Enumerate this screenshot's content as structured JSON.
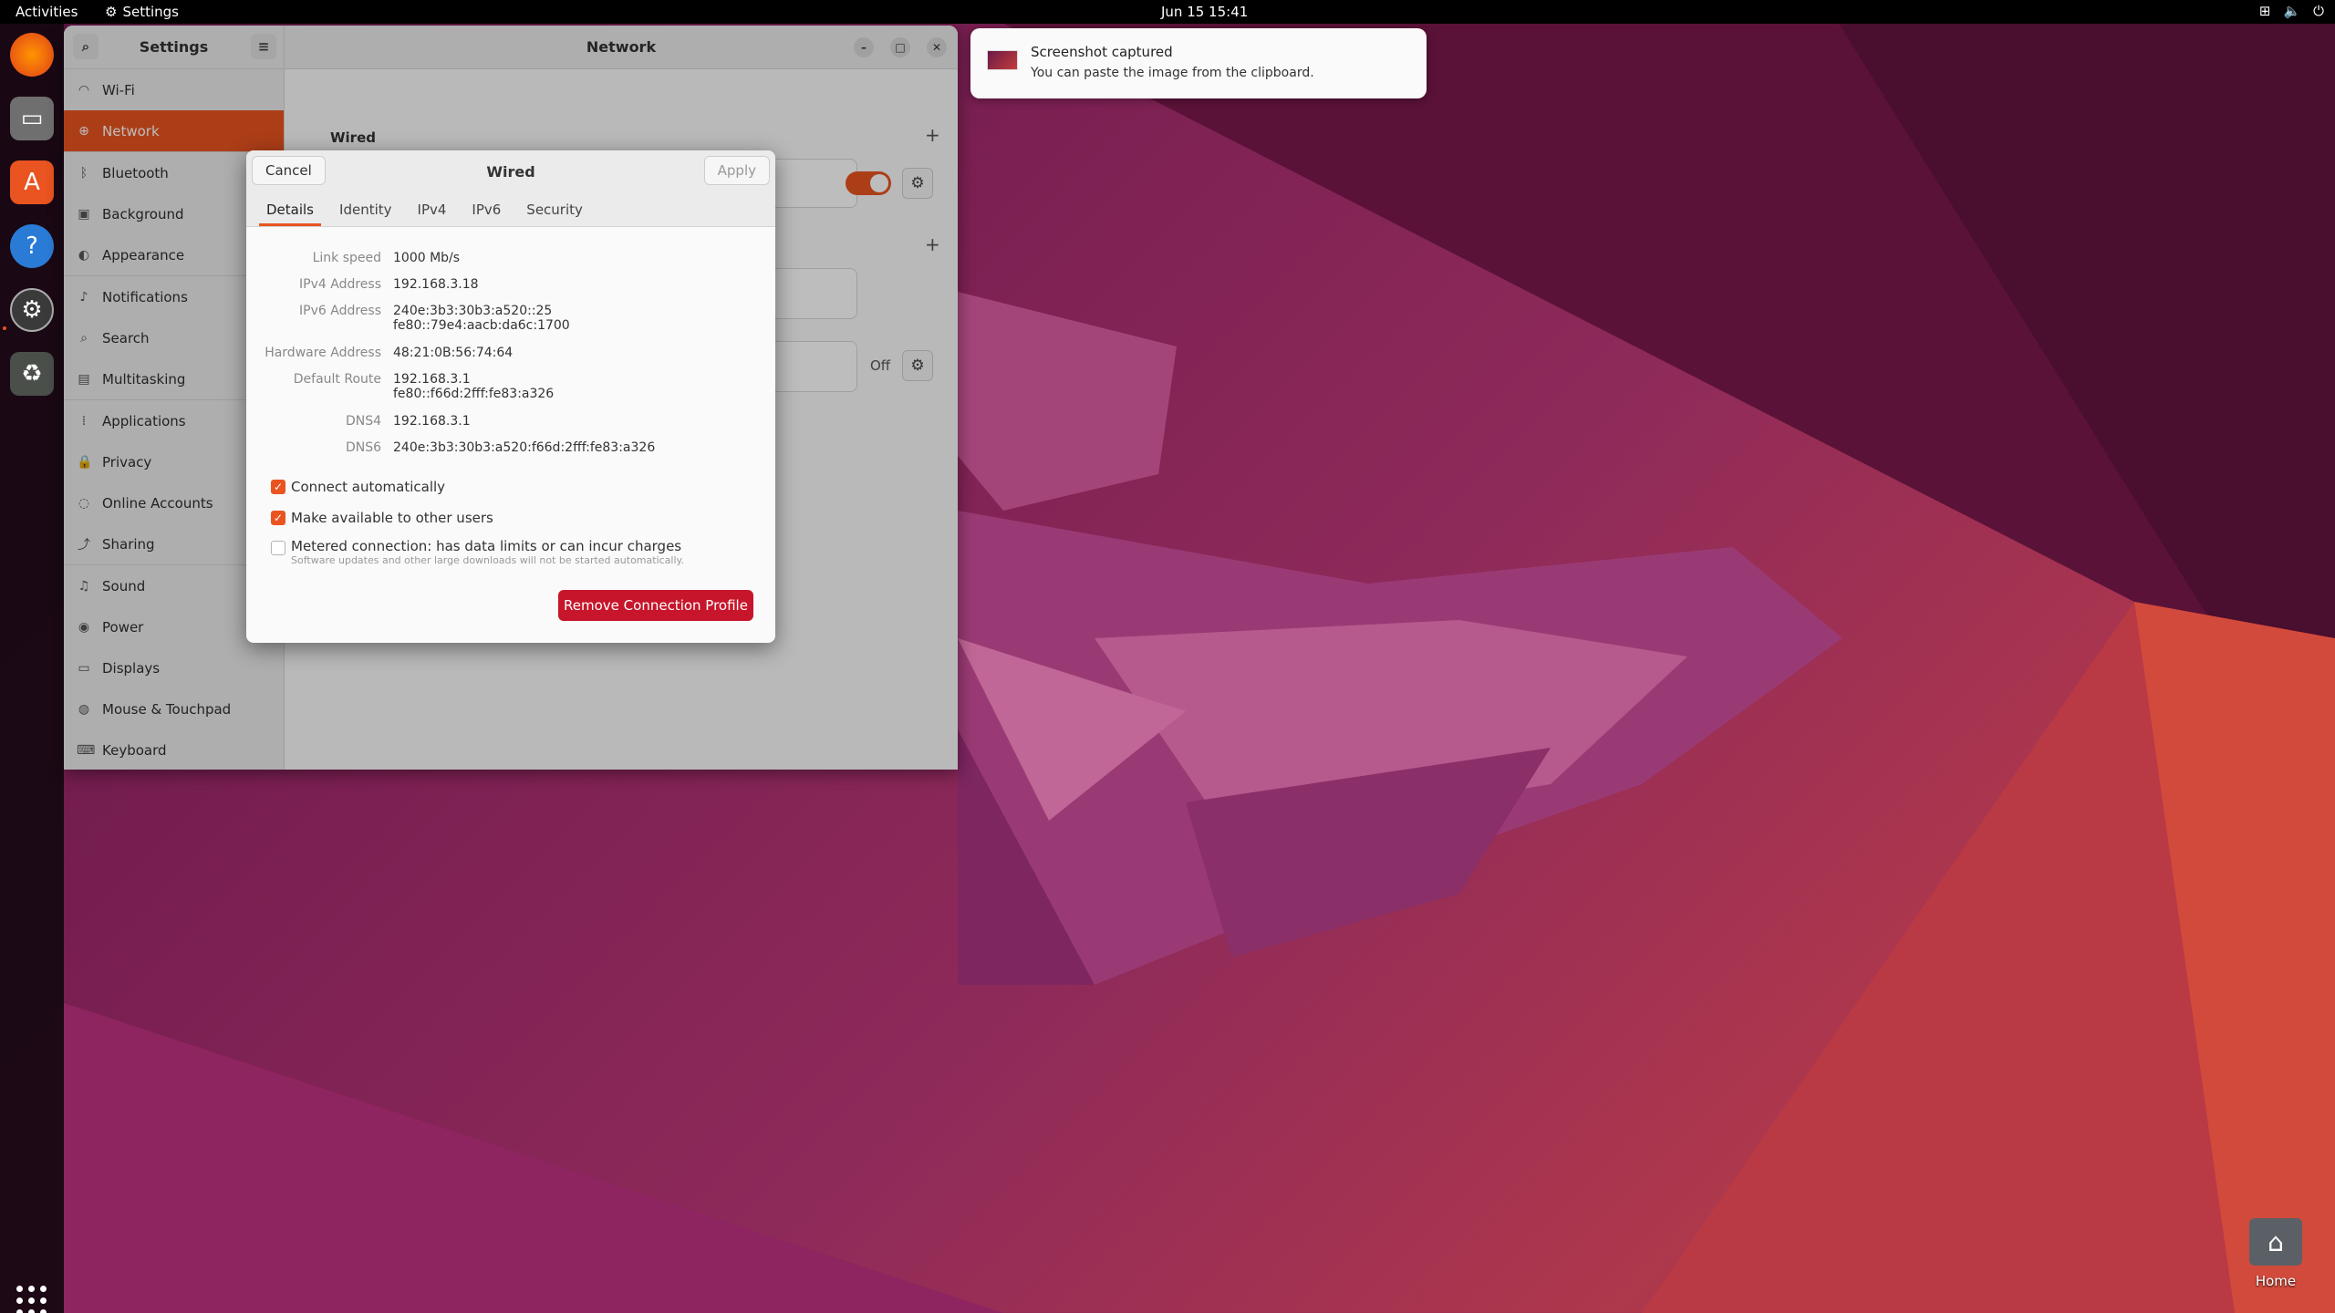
{
  "topbar": {
    "activities": "Activities",
    "app_name": "Settings",
    "clock": "Jun 15  15:41"
  },
  "settings": {
    "sidebar_title": "Settings",
    "page_title": "Network",
    "sidebar_items": [
      {
        "label": "Wi-Fi",
        "icon": "wifi-icon"
      },
      {
        "label": "Network",
        "icon": "network-icon"
      },
      {
        "label": "Bluetooth",
        "icon": "bluetooth-icon"
      },
      {
        "label": "Background",
        "icon": "background-icon"
      },
      {
        "label": "Appearance",
        "icon": "appearance-icon"
      },
      {
        "label": "Notifications",
        "icon": "bell-icon"
      },
      {
        "label": "Search",
        "icon": "search-icon"
      },
      {
        "label": "Multitasking",
        "icon": "multitasking-icon"
      },
      {
        "label": "Applications",
        "icon": "apps-icon"
      },
      {
        "label": "Privacy",
        "icon": "lock-icon"
      },
      {
        "label": "Online Accounts",
        "icon": "cloud-icon"
      },
      {
        "label": "Sharing",
        "icon": "share-icon"
      },
      {
        "label": "Sound",
        "icon": "music-note-icon"
      },
      {
        "label": "Power",
        "icon": "power-icon"
      },
      {
        "label": "Displays",
        "icon": "display-icon"
      },
      {
        "label": "Mouse & Touchpad",
        "icon": "mouse-icon"
      },
      {
        "label": "Keyboard",
        "icon": "keyboard-icon"
      }
    ],
    "wired_section": "Wired",
    "vpn_off_label": "Off"
  },
  "dialog": {
    "title": "Wired",
    "cancel": "Cancel",
    "apply": "Apply",
    "tabs": [
      "Details",
      "Identity",
      "IPv4",
      "IPv6",
      "Security"
    ],
    "details": {
      "link_speed_label": "Link speed",
      "link_speed": "1000 Mb/s",
      "ipv4_label": "IPv4 Address",
      "ipv4": "192.168.3.18",
      "ipv6_label": "IPv6 Address",
      "ipv6_1": "240e:3b3:30b3:a520::25",
      "ipv6_2": "fe80::79e4:aacb:da6c:1700",
      "hw_label": "Hardware Address",
      "hw": "48:21:0B:56:74:64",
      "route_label": "Default Route",
      "route_1": "192.168.3.1",
      "route_2": "fe80::f66d:2fff:fe83:a326",
      "dns4_label": "DNS4",
      "dns4": "192.168.3.1",
      "dns6_label": "DNS6",
      "dns6": "240e:3b3:30b3:a520:f66d:2fff:fe83:a326"
    },
    "connect_auto": "Connect automatically",
    "make_available": "Make available to other users",
    "metered": "Metered connection: has data limits or can incur charges",
    "metered_sub": "Software updates and other large downloads will not be started automatically.",
    "remove": "Remove Connection Profile"
  },
  "notification": {
    "title": "Screenshot captured",
    "body": "You can paste the image from the clipboard."
  },
  "desktop": {
    "home_label": "Home"
  },
  "colors": {
    "accent": "#e95420",
    "danger": "#c7162b"
  }
}
